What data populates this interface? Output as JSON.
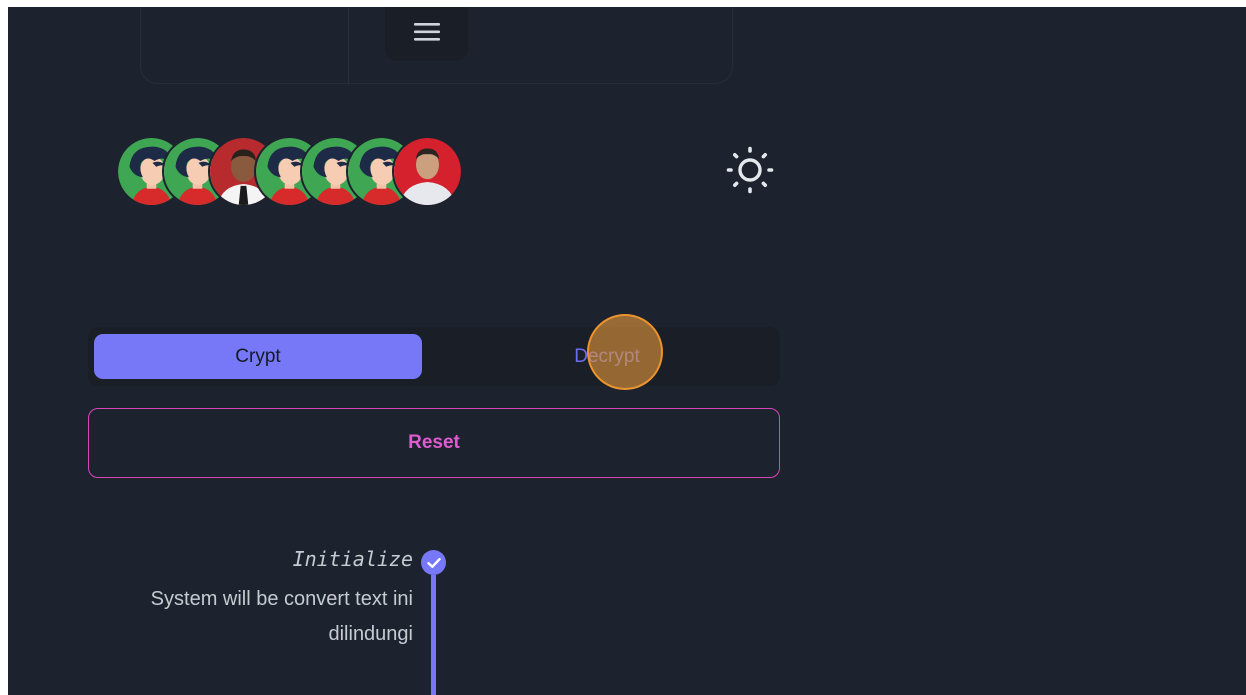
{
  "menu": {
    "icon": "hamburger-menu-icon"
  },
  "avatars": [
    {
      "kind": "cartoon",
      "icon": "avatar-cartoon-icon"
    },
    {
      "kind": "cartoon",
      "icon": "avatar-cartoon-icon"
    },
    {
      "kind": "photo-red",
      "icon": "avatar-photo-icon"
    },
    {
      "kind": "cartoon",
      "icon": "avatar-cartoon-icon"
    },
    {
      "kind": "cartoon",
      "icon": "avatar-cartoon-icon"
    },
    {
      "kind": "cartoon",
      "icon": "avatar-cartoon-icon"
    },
    {
      "kind": "photo-white",
      "icon": "avatar-photo-icon"
    }
  ],
  "theme_toggle": {
    "icon": "sun-icon"
  },
  "mode_tabs": {
    "crypt_label": "Crypt",
    "decrypt_label": "Decrypt",
    "active": "Crypt"
  },
  "reset": {
    "label": "Reset"
  },
  "timeline": {
    "step_title": "Initialize",
    "step_description": "System will be convert text ini dilindungi",
    "status_icon": "check-circle-icon"
  },
  "colors": {
    "background": "#1d232e",
    "accent": "#7678f7",
    "reset_accent": "#d546b8",
    "text": "#c6cad1"
  }
}
